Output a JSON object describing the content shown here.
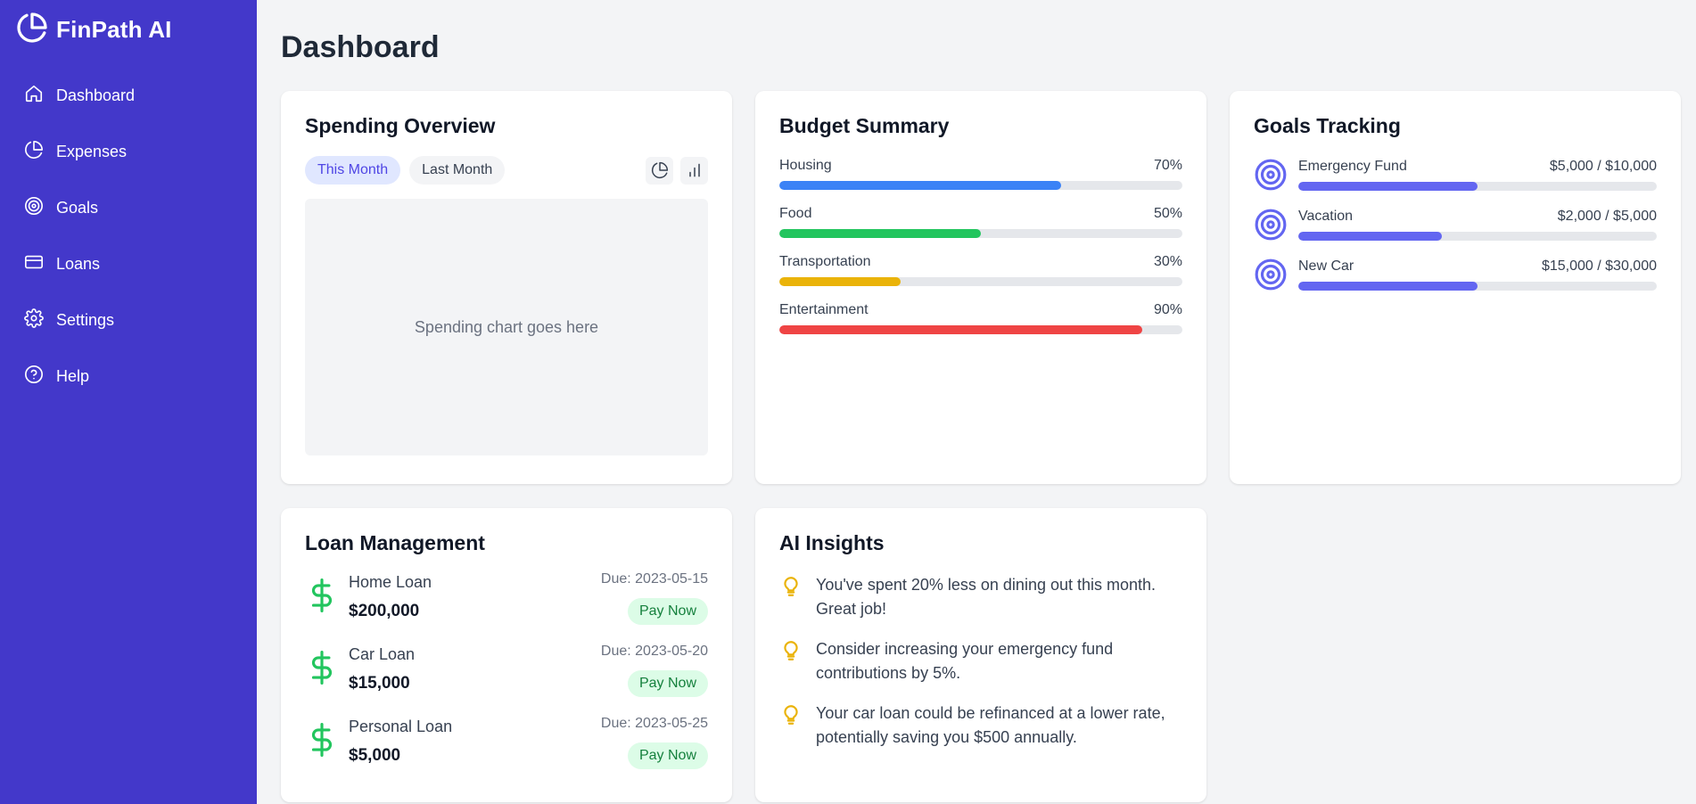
{
  "app": {
    "name": "FinPath AI"
  },
  "sidebar": {
    "items": [
      {
        "label": "Dashboard",
        "icon": "home-icon"
      },
      {
        "label": "Expenses",
        "icon": "pie-chart-icon"
      },
      {
        "label": "Goals",
        "icon": "target-icon"
      },
      {
        "label": "Loans",
        "icon": "credit-card-icon"
      },
      {
        "label": "Settings",
        "icon": "gear-icon"
      },
      {
        "label": "Help",
        "icon": "help-circle-icon"
      }
    ]
  },
  "page": {
    "title": "Dashboard"
  },
  "spending": {
    "title": "Spending Overview",
    "tabs": [
      "This Month",
      "Last Month"
    ],
    "active_tab": "This Month",
    "chart_placeholder": "Spending chart goes here"
  },
  "budget": {
    "title": "Budget Summary",
    "items": [
      {
        "label": "Housing",
        "percent_text": "70%",
        "percent": 70,
        "color": "#3b82f6"
      },
      {
        "label": "Food",
        "percent_text": "50%",
        "percent": 50,
        "color": "#22c55e"
      },
      {
        "label": "Transportation",
        "percent_text": "30%",
        "percent": 30,
        "color": "#eab308"
      },
      {
        "label": "Entertainment",
        "percent_text": "90%",
        "percent": 90,
        "color": "#ef4444"
      }
    ]
  },
  "goals": {
    "title": "Goals Tracking",
    "items": [
      {
        "label": "Emergency Fund",
        "amount": "$5,000 / $10,000",
        "progress": 0.5
      },
      {
        "label": "Vacation",
        "amount": "$2,000 / $5,000",
        "progress": 0.4
      },
      {
        "label": "New Car",
        "amount": "$15,000 / $30,000",
        "progress": 0.5
      }
    ],
    "color": "#6366f1"
  },
  "loans": {
    "title": "Loan Management",
    "pay_label": "Pay Now",
    "items": [
      {
        "name": "Home Loan",
        "amount": "$200,000",
        "due": "Due: 2023-05-15"
      },
      {
        "name": "Car Loan",
        "amount": "$15,000",
        "due": "Due: 2023-05-20"
      },
      {
        "name": "Personal Loan",
        "amount": "$5,000",
        "due": "Due: 2023-05-25"
      }
    ]
  },
  "insights": {
    "title": "AI Insights",
    "items": [
      "You've spent 20% less on dining out this month. Great job!",
      "Consider increasing your emergency fund contributions by 5%.",
      "Your car loan could be refinanced at a lower rate, potentially saving you $500 annually."
    ]
  },
  "colors": {
    "sidebar": "#4338ca",
    "accent": "#4f46e5",
    "success": "#22c55e",
    "insight_icon": "#eab308"
  }
}
